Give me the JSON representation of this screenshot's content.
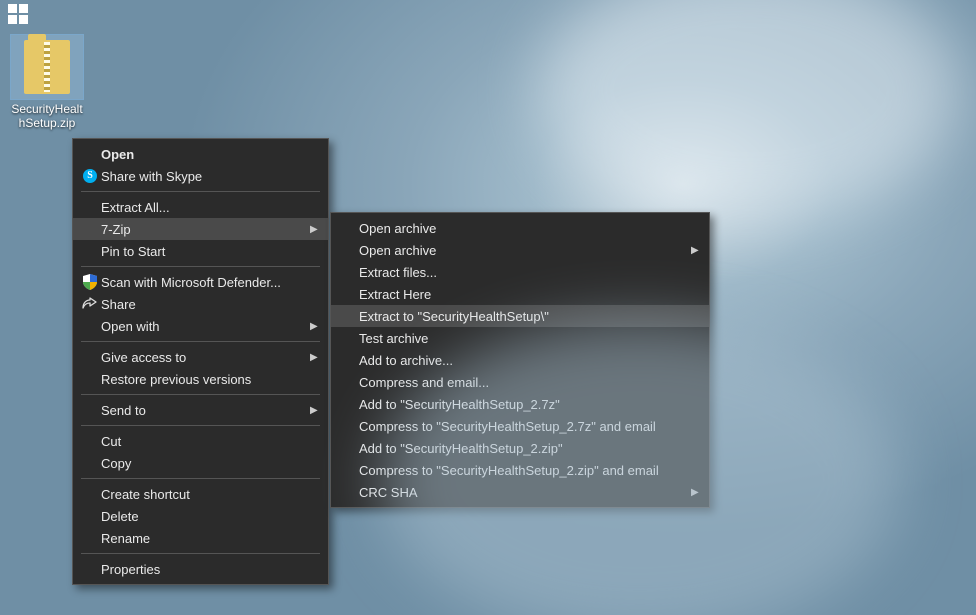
{
  "desktop": {
    "file": {
      "name": "SecurityHealthSetup.zip"
    }
  },
  "menu1": {
    "open": "Open",
    "share_skype": "Share with Skype",
    "extract_all": "Extract All...",
    "seven_zip": "7-Zip",
    "pin_start": "Pin to Start",
    "scan_defender": "Scan with Microsoft Defender...",
    "share": "Share",
    "open_with": "Open with",
    "give_access": "Give access to",
    "restore_prev": "Restore previous versions",
    "send_to": "Send to",
    "cut": "Cut",
    "copy": "Copy",
    "create_shortcut": "Create shortcut",
    "delete": "Delete",
    "rename": "Rename",
    "properties": "Properties"
  },
  "menu2": {
    "open_archive1": "Open archive",
    "open_archive2": "Open archive",
    "extract_files": "Extract files...",
    "extract_here": "Extract Here",
    "extract_to": "Extract to \"SecurityHealthSetup\\\"",
    "test_archive": "Test archive",
    "add_archive": "Add to archive...",
    "compress_email": "Compress and email...",
    "add_7z": "Add to \"SecurityHealthSetup_2.7z\"",
    "compress_7z_email": "Compress to \"SecurityHealthSetup_2.7z\" and email",
    "add_zip": "Add to \"SecurityHealthSetup_2.zip\"",
    "compress_zip_email": "Compress to \"SecurityHealthSetup_2.zip\" and email",
    "crc_sha": "CRC SHA"
  }
}
